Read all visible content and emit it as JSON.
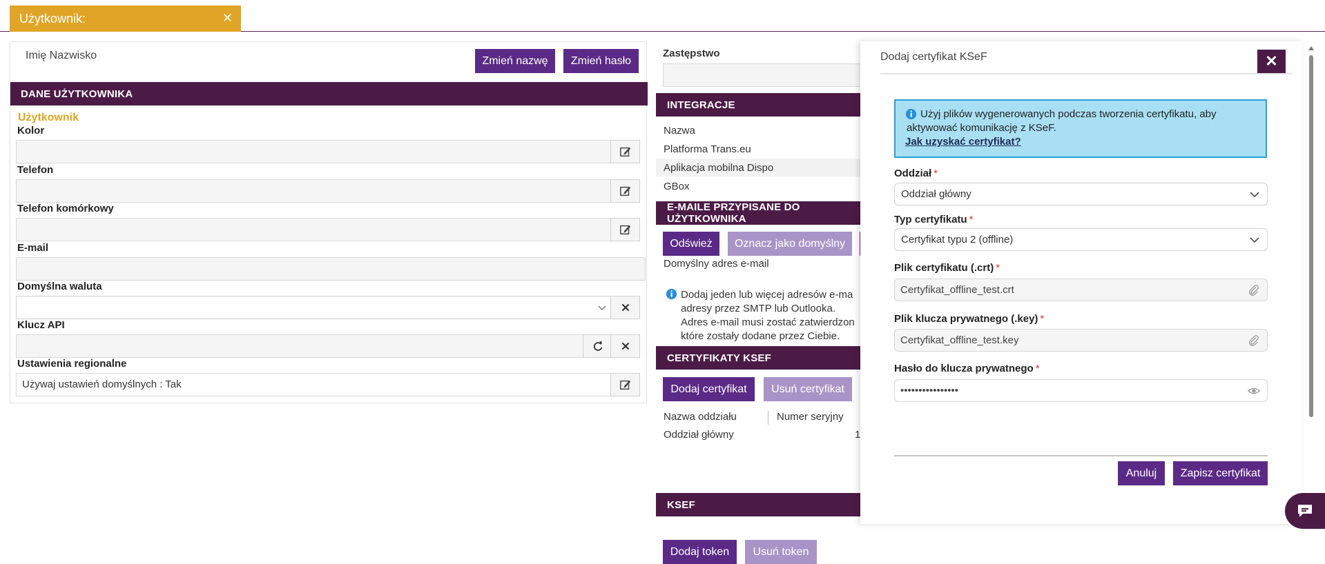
{
  "tab": {
    "title": "Użytkownik:"
  },
  "user_panel": {
    "name": "Imię Nazwisko",
    "rename_label": "Zmień nazwę",
    "change_password_label": "Zmień hasło",
    "section_title": "DANE UŻYTKOWNIKA",
    "subtitle": "Użytkownik",
    "fields": {
      "color": "Kolor",
      "phone": "Telefon",
      "mobile": "Telefon komórkowy",
      "email": "E-mail",
      "currency": "Domyślna waluta",
      "api_key": "Klucz API",
      "regional": "Ustawienia regionalne"
    },
    "regional_value": "Używaj ustawień domyślnych : Tak"
  },
  "middle_panel": {
    "substitute_label": "Zastępstwo",
    "integrations_title": "INTEGRACJE",
    "integrations": [
      "Nazwa",
      "Platforma Trans.eu",
      "Aplikacja mobilna Dispo",
      "GBox"
    ],
    "emails_title": "E-MAILE PRZYPISANE DO UŻYTKOWNIKA",
    "refresh_label": "Odśwież",
    "mark_default_label": "Oznacz jako domyślny",
    "default_email_label": "Domyślny adres e-mail",
    "info_lines": [
      "Dodaj jeden lub więcej adresów e-ma",
      "adresy przez SMTP lub Outlooka.",
      "Adres e-mail musi zostać zatwierdzon",
      "które zostały dodane przez Ciebie."
    ],
    "certs_title": "CERTYFIKATY KSEF",
    "add_cert_label": "Dodaj certyfikat",
    "remove_cert_label": "Usuń certyfikat",
    "cert_columns": [
      "Nazwa oddziału",
      "Numer seryjny"
    ],
    "cert_row": {
      "branch": "Oddział główny",
      "serial": "1"
    },
    "ksef_title": "KSEF",
    "add_token_label": "Dodaj token",
    "remove_token_label": "Usuń token"
  },
  "modal": {
    "title": "Dodaj certyfikat KSeF",
    "info_text": "Użyj plików wygenerowanych podczas tworzenia certyfikatu, aby aktywować komunikację z KSeF.",
    "info_link": "Jak uzyskać certyfikat?",
    "branch_label": "Oddział",
    "branch_value": "Oddział główny",
    "cert_type_label": "Typ certyfikatu",
    "cert_type_value": "Certyfikat typu 2 (offline)",
    "cert_file_label": "Plik certyfikatu (.crt)",
    "cert_file_value": "Certyfikat_offline_test.crt",
    "key_file_label": "Plik klucza prywatnego (.key)",
    "key_file_value": "Certyfikat_offline_test.key",
    "password_label": "Hasło do klucza prywatnego",
    "password_value": "••••••••••••••••",
    "required_mark": "*",
    "cancel_label": "Anuluj",
    "save_label": "Zapisz certyfikat"
  },
  "colors": {
    "accent": "#5b2a86",
    "header": "#4b1b46",
    "tab": "#e0a526",
    "info_bg": "#a8dff3"
  }
}
